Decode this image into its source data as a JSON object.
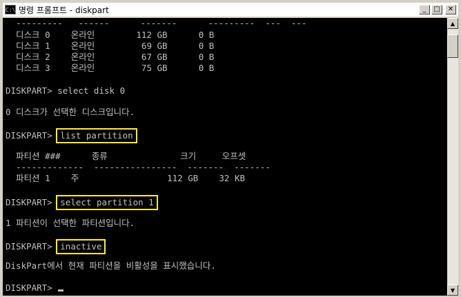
{
  "window": {
    "title": "명령 프롬프트 - diskpart",
    "icon_label": "C:\\",
    "minimize_glyph": "_",
    "maximize_glyph": "□",
    "close_glyph": "✕"
  },
  "console": {
    "lines": [
      "  ---------   ------      -------      ---------  ---  ---",
      "  디스크 0    온라인        112 GB      0 B",
      "  디스크 1    온라인         69 GB      0 B",
      "  디스크 2    온라인         67 GB      0 B",
      "  디스크 3    온라인         75 GB      0 B",
      "",
      "DISKPART> select disk 0",
      "",
      "0 디스크가 선택한 디스크입니다.",
      "",
      "DISKPART> ",
      "",
      "  파티션 ###      종류              크기     오프셋",
      "  -------------  ----------------  -------  -------",
      "  파티션 1    주                 112 GB    32 KB",
      "",
      "DISKPART> ",
      "",
      "1 파티션이 선택한 파티션입니다.",
      "",
      "DISKPART> ",
      "",
      "DiskPart에서 현재 파티션을 비활성을 표시했습니다.",
      "",
      "DISKPART> "
    ],
    "highlighted_commands": {
      "list_partition": "list partition",
      "select_partition": "select partition 1",
      "inactive": "inactive"
    }
  },
  "colors": {
    "console_bg": "#000000",
    "console_fg": "#c0c0c0",
    "highlight_border": "#ffeb3b"
  },
  "scrollbar": {
    "up_glyph": "▲",
    "down_glyph": "▼"
  }
}
